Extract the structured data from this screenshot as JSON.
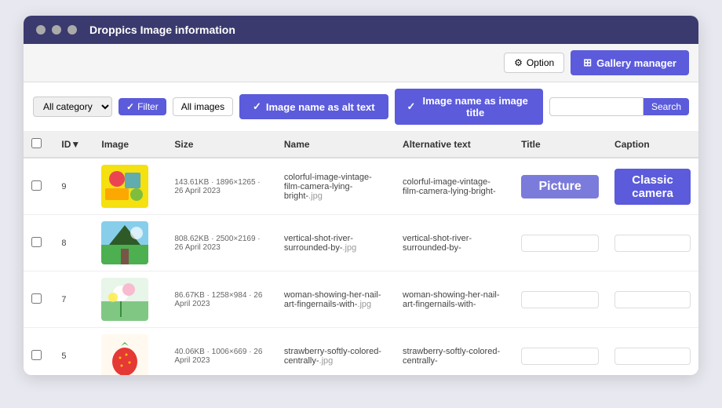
{
  "window": {
    "title": "Droppics Image information",
    "traffic_lights": [
      "dot1",
      "dot2",
      "dot3"
    ]
  },
  "toolbar": {
    "option_label": "Option",
    "gallery_manager_label": "Gallery manager"
  },
  "filter_bar": {
    "category_value": "All category",
    "filter_label": "Filter",
    "all_images_label": "All images",
    "alt_text_toggle_label": "Image name as alt text",
    "title_toggle_label": "Image name as image title",
    "search_placeholder": "",
    "search_label": "Search"
  },
  "table": {
    "columns": [
      "ID▼",
      "Image",
      "Size",
      "Name",
      "Alternative text",
      "Title",
      "Caption"
    ],
    "rows": [
      {
        "id": "9",
        "size": "143.61KB · 1896×1265 · 26 April 2023",
        "name": "colorful-image-vintage-film-camera-lying-bright-",
        "name_ext": ".jpg",
        "alt": "colorful-image-vintage-film-camera-lying-bright-",
        "title_value": "Picture",
        "caption_value": "Classic camera",
        "image_colors": [
          "#f5d020",
          "#2196f3",
          "#e91e63",
          "#ff9800"
        ],
        "image_type": "colorful"
      },
      {
        "id": "8",
        "size": "808.62KB · 2500×2169 · 26 April 2023",
        "name": "vertical-shot-river-surrounded-by-",
        "name_ext": ".jpg",
        "alt": "vertical-shot-river-surrounded-by-",
        "title_value": "",
        "caption_value": "",
        "image_type": "nature"
      },
      {
        "id": "7",
        "size": "86.67KB · 1258×984 · 26 April 2023",
        "name": "woman-showing-her-nail-art-fingernails-with-",
        "name_ext": ".jpg",
        "alt": "woman-showing-her-nail-art-fingernails-with-",
        "title_value": "",
        "caption_value": "",
        "image_type": "flowers"
      },
      {
        "id": "5",
        "size": "40.06KB · 1006×669 · 26 April 2023",
        "name": "strawberry-softly-colored-centrally-",
        "name_ext": ".jpg",
        "alt": "strawberry-softly-colored-centrally-",
        "title_value": "",
        "caption_value": "",
        "image_type": "strawberry"
      }
    ]
  }
}
